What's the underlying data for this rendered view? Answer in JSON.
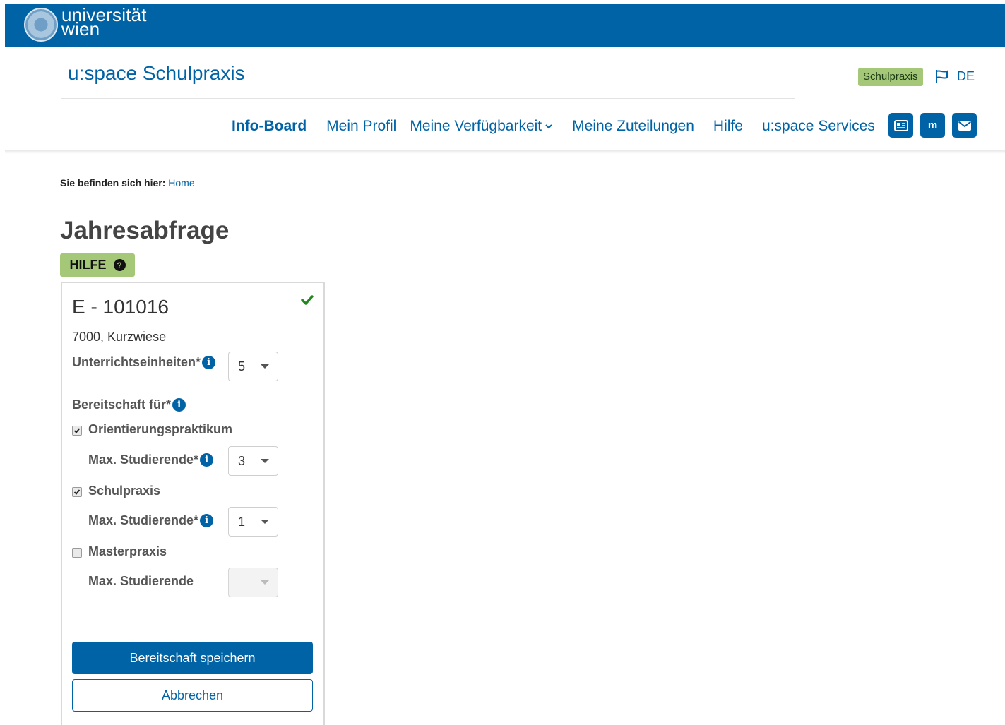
{
  "header": {
    "logo_line1": "universität",
    "logo_line2": "wien",
    "site_title": "u:space Schulpraxis",
    "badge": "Schulpraxis",
    "language": "DE"
  },
  "nav": {
    "items": [
      {
        "label": "Info-Board",
        "active": true
      },
      {
        "label": "Mein Profil"
      },
      {
        "label": "Meine Verfügbarkeit",
        "dropdown": true
      },
      {
        "label": "Meine Zuteilungen"
      },
      {
        "label": "Hilfe"
      },
      {
        "label": "u:space Services"
      }
    ],
    "icon_buttons": [
      "id-card-icon",
      "moodle-icon",
      "mail-icon"
    ],
    "moodle_glyph": "m"
  },
  "breadcrumb": {
    "prefix": "Sie befinden sich hier:",
    "home": "Home"
  },
  "page": {
    "title": "Jahresabfrage",
    "help_label": "HILFE"
  },
  "card": {
    "title": "E - 101016",
    "address": "7000, Kurzwiese",
    "status_icon": "check-icon",
    "units_label": "Unterrichtseinheiten*",
    "units_value": "5",
    "readiness_label": "Bereitschaft für*",
    "options": [
      {
        "label": "Orientierungspraktikum",
        "checked": true,
        "max_label": "Max. Studierende*",
        "max_value": "3",
        "disabled": false
      },
      {
        "label": "Schulpraxis",
        "checked": true,
        "max_label": "Max. Studierende*",
        "max_value": "1",
        "disabled": false
      },
      {
        "label": "Masterpraxis",
        "checked": false,
        "max_label": "Max. Studierende",
        "max_value": "",
        "disabled": true
      }
    ],
    "save_label": "Bereitschaft speichern",
    "cancel_label": "Abbrechen"
  },
  "colors": {
    "brand": "#0063a6",
    "accent_green": "#a4c778",
    "check_green": "#1e8a1e"
  }
}
